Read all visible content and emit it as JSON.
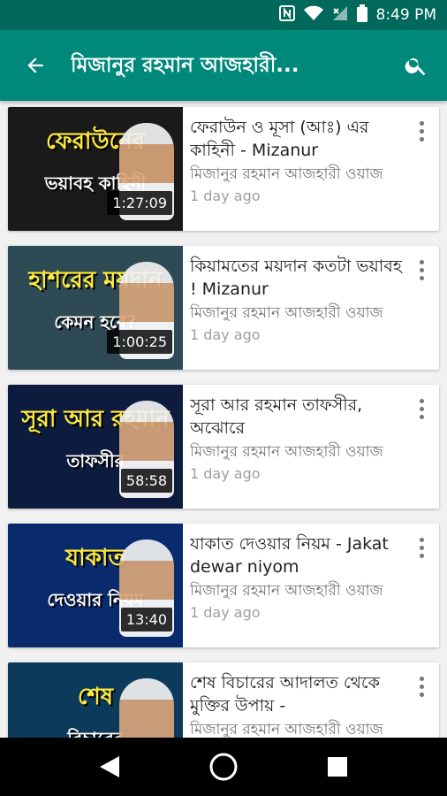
{
  "status_bar": {
    "time": "8:49 PM",
    "nfc_icon": "nfc-icon",
    "wifi_icon": "wifi-icon",
    "signal_icon": "signal-icon",
    "battery_icon": "battery-icon"
  },
  "app_bar": {
    "title": "মিজানুর রহমান আজহারী...",
    "back_icon": "arrow-back-icon",
    "search_icon": "search-icon",
    "color": "#00897b",
    "status_color": "#00695c"
  },
  "videos": [
    {
      "title": "ফেরাউন ও মূসা (আঃ) এর কাহিনী - Mizanur",
      "channel": "মিজানুর রহমান আজহারী ওয়াজ",
      "age": "1 day ago",
      "duration": "1:27:09",
      "thumb_text_1": "ফেরাউনের",
      "thumb_text_2": "ভয়াবহ কাহিনী",
      "thumb_bg": "#1a1a1a"
    },
    {
      "title": "কিয়ামতের ময়দান কতটা ভয়াবহ ! Mizanur",
      "channel": "মিজানুর রহমান আজহারী ওয়াজ",
      "age": "1 day ago",
      "duration": "1:00:25",
      "thumb_text_1": "হাশরের ময়দান",
      "thumb_text_2": "কেমন হবে?",
      "thumb_bg": "#2e4a55"
    },
    {
      "title": "সূরা আর রহমান তাফসীর, অঝোরে",
      "channel": "মিজানুর রহমান আজহারী ওয়াজ",
      "age": "1 day ago",
      "duration": "58:58",
      "thumb_text_1": "সূরা আর রহমান",
      "thumb_text_2": "তাফসীর",
      "thumb_bg": "#0d1b3e"
    },
    {
      "title": "যাকাত দেওয়ার নিয়ম - Jakat dewar niyom",
      "channel": "মিজানুর রহমান আজহারী ওয়াজ",
      "age": "1 day ago",
      "duration": "13:40",
      "thumb_text_1": "যাকাত",
      "thumb_text_2": "দেওয়ার নিয়ম",
      "thumb_bg": "#0a2a6e"
    },
    {
      "title": "শেষ বিচারের আদালত থেকে মুক্তির উপায় -",
      "channel": "মিজানুর রহমান আজহারী ওয়াজ",
      "age": "",
      "duration": "",
      "thumb_text_1": "শেষ",
      "thumb_text_2": "বিচারের",
      "thumb_bg": "#0b3a5a"
    }
  ],
  "nav_bar": {
    "back_icon": "nav-back-icon",
    "home_icon": "nav-home-icon",
    "recents_icon": "nav-recents-icon"
  }
}
